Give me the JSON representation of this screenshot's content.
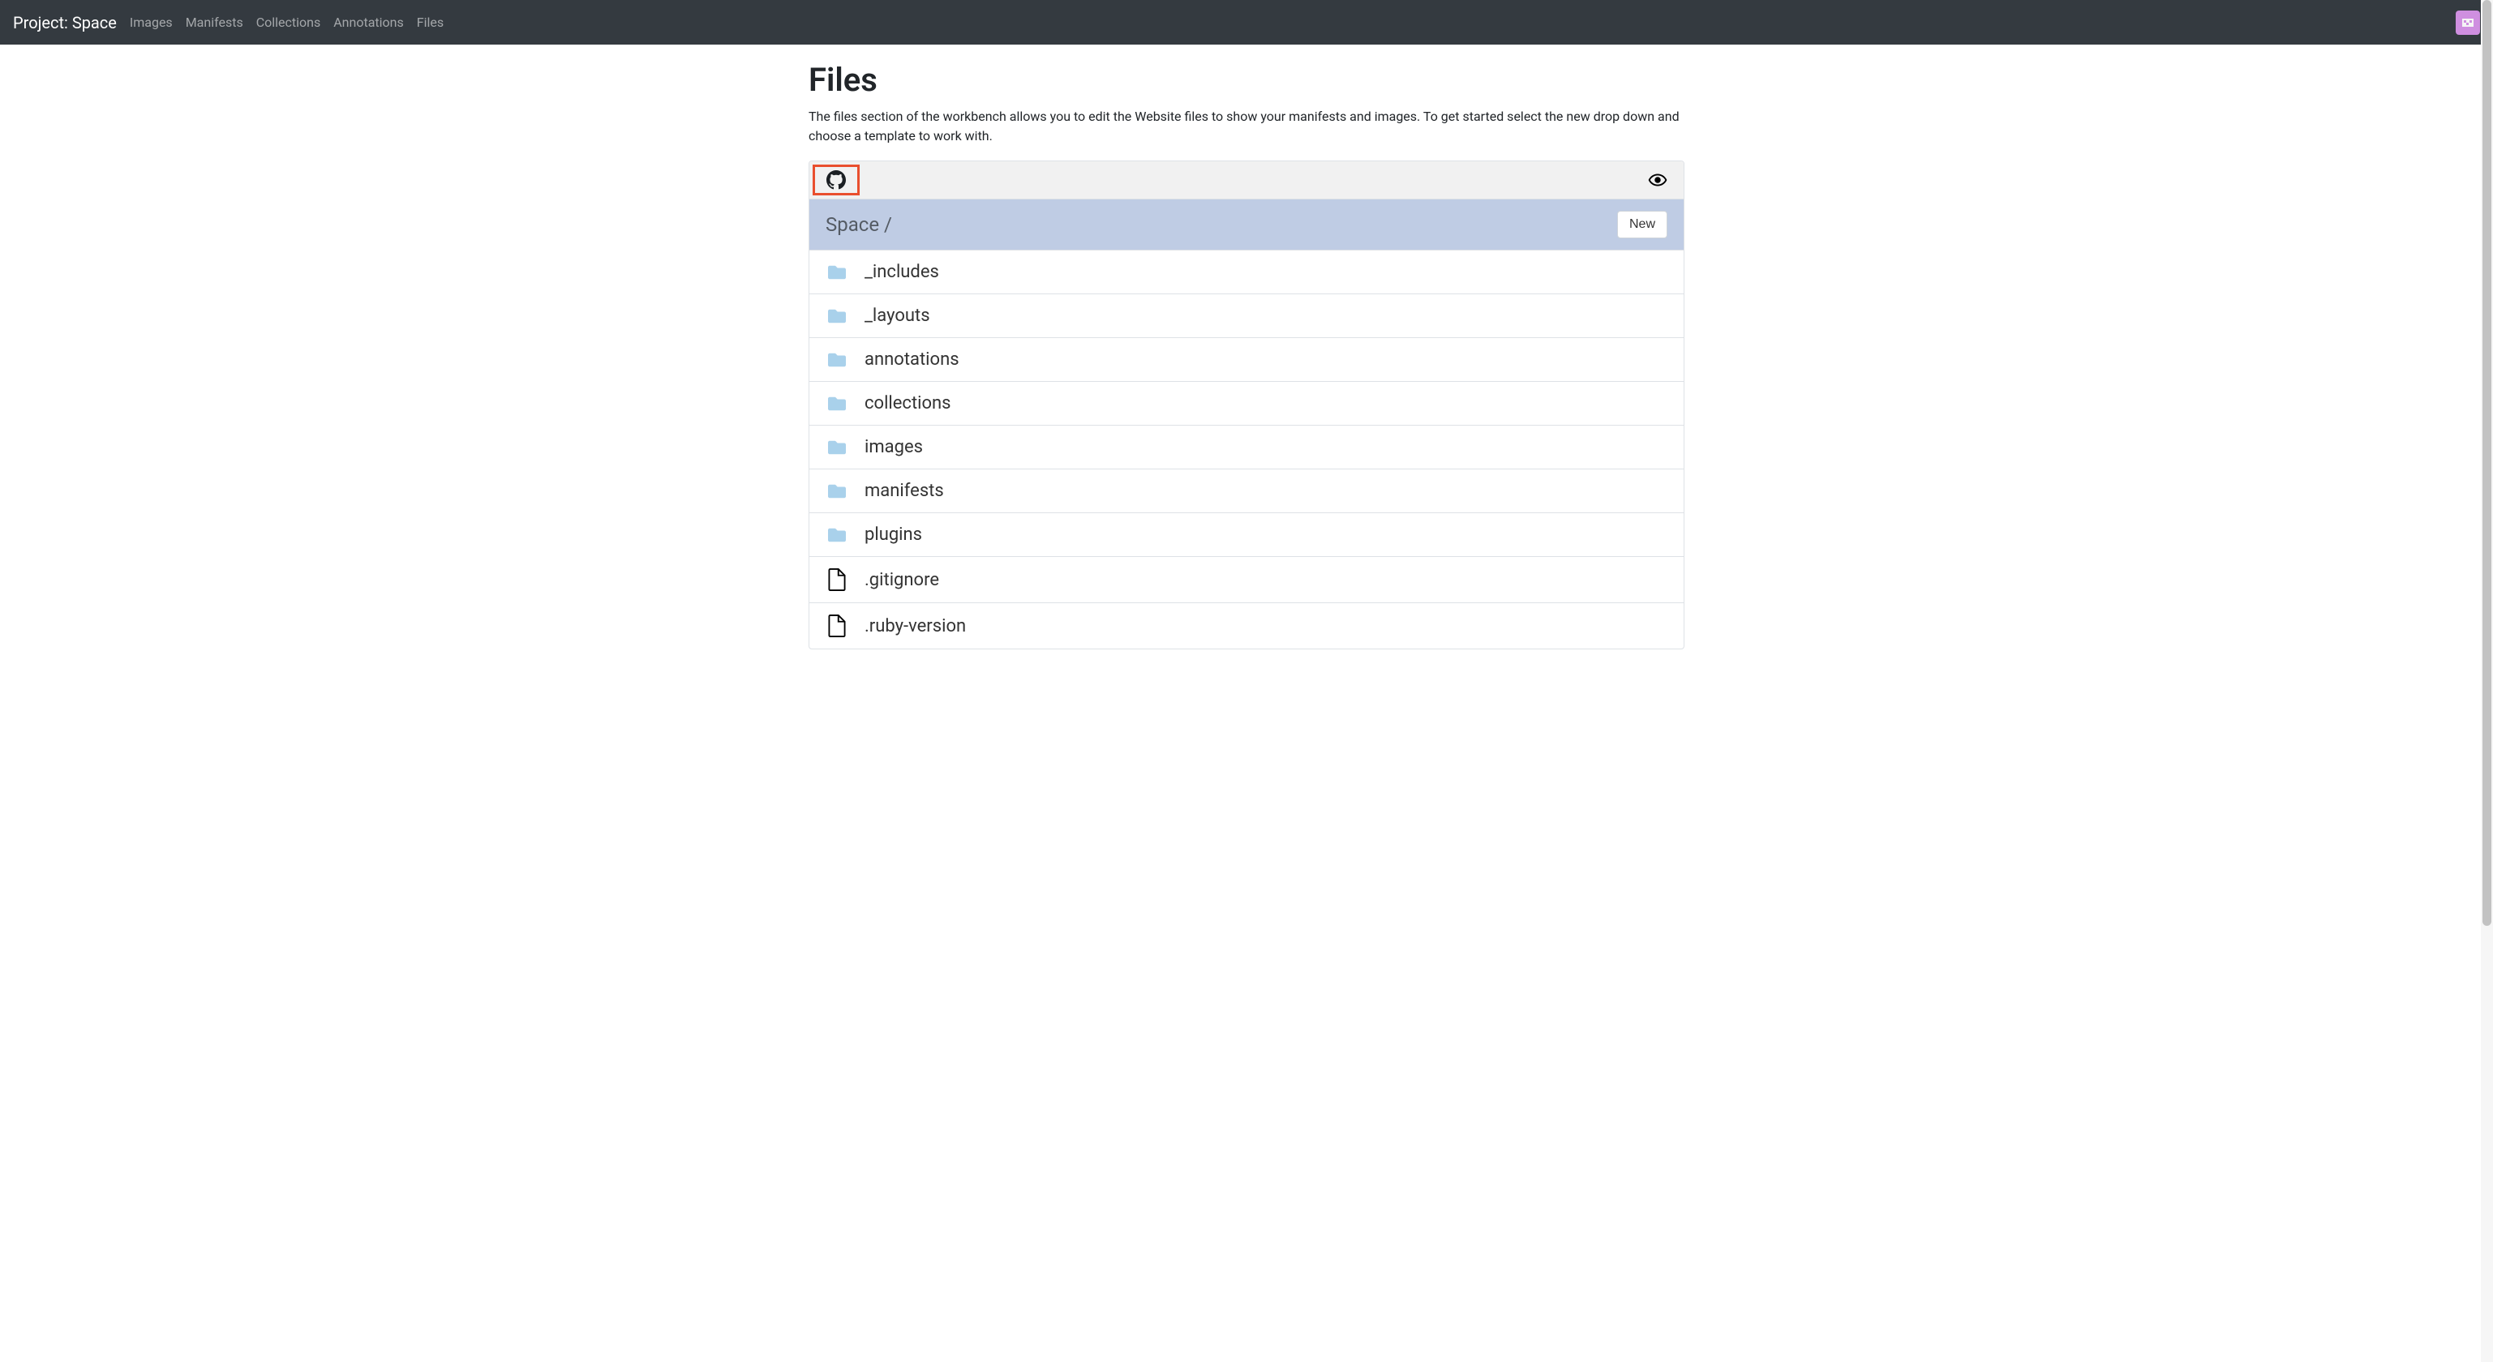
{
  "nav": {
    "brand": "Project: Space",
    "links": [
      "Images",
      "Manifests",
      "Collections",
      "Annotations",
      "Files"
    ]
  },
  "page": {
    "title": "Files",
    "description": "The files section of the workbench allows you to edit the Website files to show your manifests and images. To get started select the new drop down and choose a template to work with."
  },
  "breadcrumb": {
    "path": "Space /",
    "new_label": "New"
  },
  "files": [
    {
      "type": "folder",
      "name": "_includes"
    },
    {
      "type": "folder",
      "name": "_layouts"
    },
    {
      "type": "folder",
      "name": "annotations"
    },
    {
      "type": "folder",
      "name": "collections"
    },
    {
      "type": "folder",
      "name": "images"
    },
    {
      "type": "folder",
      "name": "manifests"
    },
    {
      "type": "folder",
      "name": "plugins"
    },
    {
      "type": "file",
      "name": ".gitignore"
    },
    {
      "type": "file",
      "name": ".ruby-version"
    }
  ]
}
